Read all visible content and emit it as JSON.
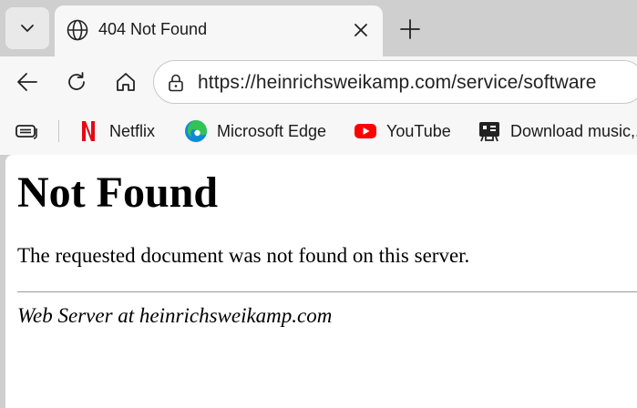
{
  "tab": {
    "title": "404 Not Found"
  },
  "toolbar": {
    "url": "https://heinrichsweikamp.com/service/software"
  },
  "favorites": [
    {
      "label": "Netflix",
      "icon": "netflix-icon",
      "color": "#e50914"
    },
    {
      "label": "Microsoft Edge",
      "icon": "edge-icon",
      "color": "#0c8ad8"
    },
    {
      "label": "YouTube",
      "icon": "youtube-icon",
      "color": "#ff0000"
    },
    {
      "label": "Download music,...",
      "icon": "music-download-icon",
      "color": "#222222"
    }
  ],
  "page": {
    "heading": "Not Found",
    "message": "The requested document was not found on this server.",
    "server_line": "Web Server at heinrichsweikamp.com"
  }
}
